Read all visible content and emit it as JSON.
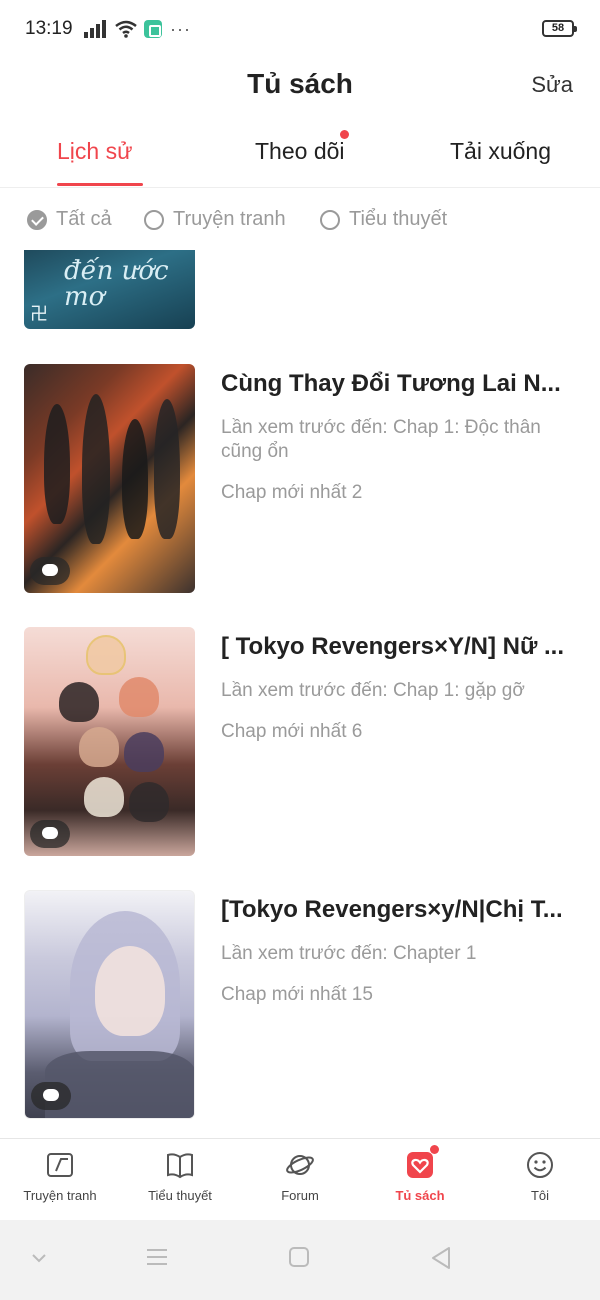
{
  "status_bar": {
    "time": "13:19",
    "battery": "58"
  },
  "header": {
    "title": "Tủ sách",
    "edit_label": "Sửa"
  },
  "tabs": [
    {
      "label": "Lịch sử",
      "active": true
    },
    {
      "label": "Theo dõi",
      "has_dot": true
    },
    {
      "label": "Tải xuống"
    }
  ],
  "filters": [
    {
      "label": "Tất cả",
      "checked": true
    },
    {
      "label": "Truyện tranh",
      "checked": false
    },
    {
      "label": "Tiểu thuyết",
      "checked": false
    }
  ],
  "list": {
    "partial_cover_text": "đến ước mơ",
    "items": [
      {
        "title": "Cùng Thay Đổi Tương Lai N...",
        "last_read": "Lần xem trước đến: Chap 1: Độc thân cũng ổn",
        "latest": "Chap mới nhất 2"
      },
      {
        "title": "[ Tokyo Revengers×Y/N] Nữ ...",
        "last_read": "Lần xem trước đến: Chap 1: gặp gỡ",
        "latest": "Chap mới nhất 6"
      },
      {
        "title": "[Tokyo Revengers×y/N|Chị T...",
        "last_read": "Lần xem trước đến: Chapter 1",
        "latest": "Chap mới nhất 15"
      }
    ]
  },
  "bottom_nav": [
    {
      "label": "Truyện tranh",
      "icon": "comic-icon"
    },
    {
      "label": "Tiểu thuyết",
      "icon": "book-icon"
    },
    {
      "label": "Forum",
      "icon": "planet-icon"
    },
    {
      "label": "Tủ sách",
      "icon": "bookshelf-icon",
      "active": true,
      "has_dot": true
    },
    {
      "label": "Tôi",
      "icon": "smiley-icon"
    }
  ],
  "colors": {
    "accent": "#f0454c",
    "muted_text": "#9a9a9a"
  }
}
